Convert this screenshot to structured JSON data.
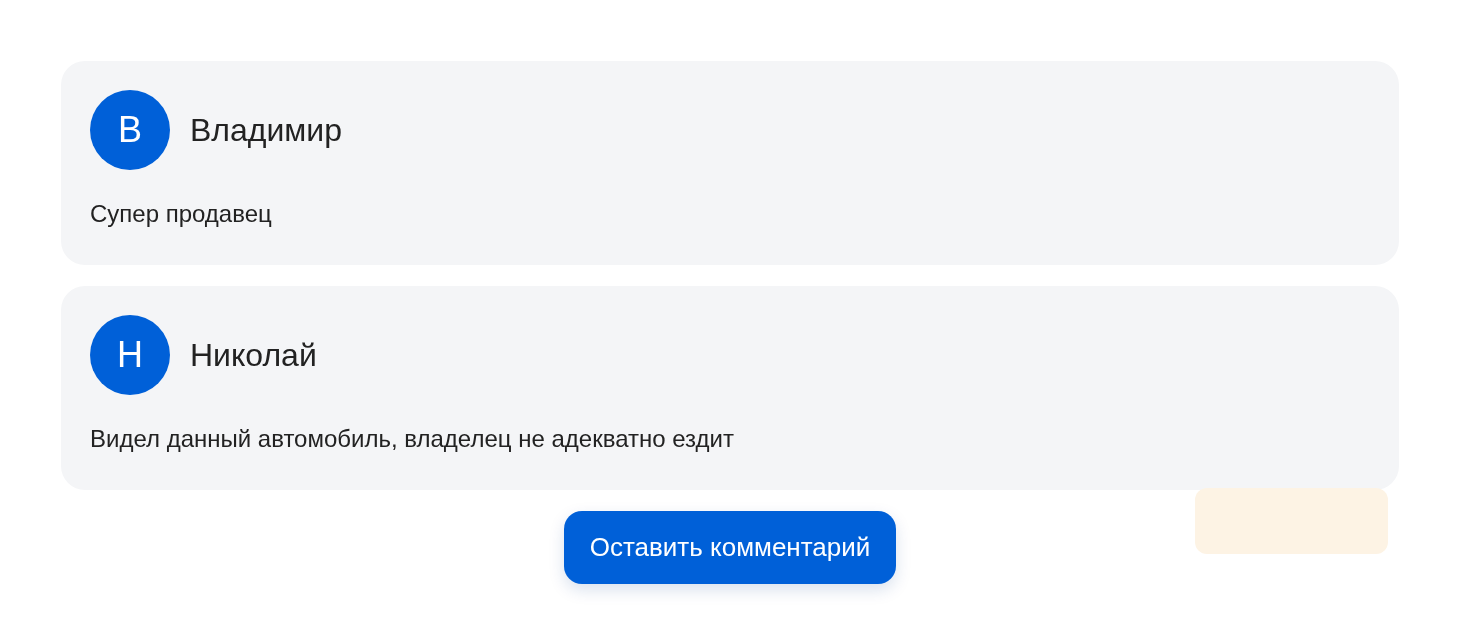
{
  "comments": [
    {
      "initial": "В",
      "author": "Владимир",
      "text": "Супер продавец"
    },
    {
      "initial": "Н",
      "author": "Николай",
      "text": "Видел данный автомобиль, владелец не адекватно ездит"
    }
  ],
  "button": {
    "label": "Оставить комментарий"
  }
}
